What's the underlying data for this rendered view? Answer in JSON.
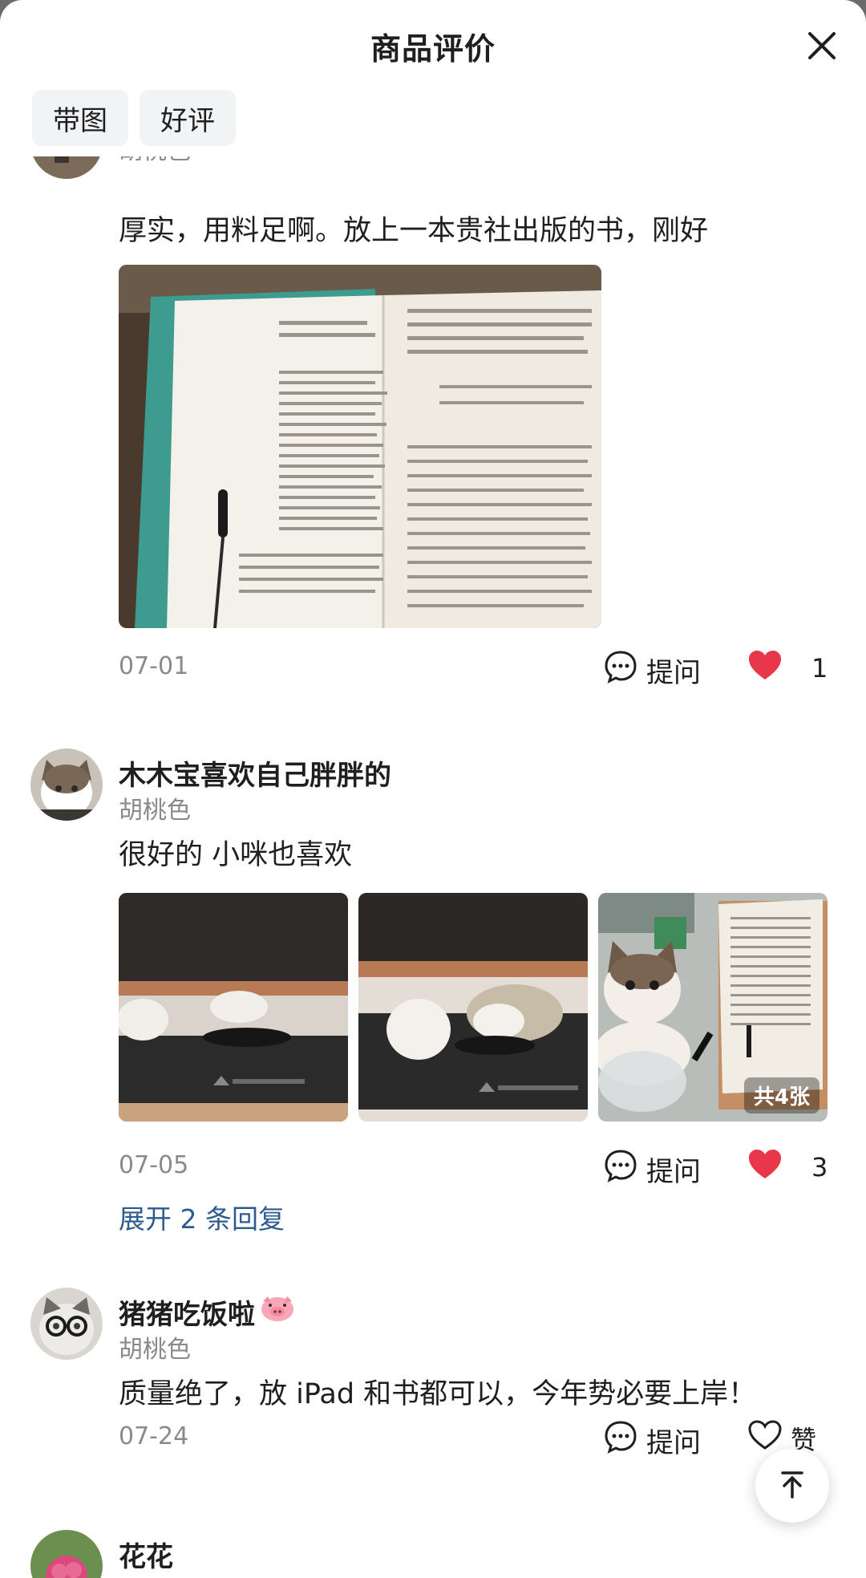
{
  "header": {
    "title": "商品评价"
  },
  "filters": [
    "带图",
    "好评"
  ],
  "reviews": [
    {
      "variant": "胡桃色",
      "text": "厚实，用料足啊。放上一本贵社出版的书，刚好",
      "date": "07-01",
      "ask_label": "提问",
      "like_count": "1",
      "liked": true
    },
    {
      "user": "木木宝喜欢自己胖胖的",
      "variant": "胡桃色",
      "text": "很好的 小咪也喜欢",
      "photo_count_badge": "共4张",
      "date": "07-05",
      "ask_label": "提问",
      "like_count": "3",
      "liked": true,
      "expand_replies": "展开 2 条回复"
    },
    {
      "user": "猪猪吃饭啦",
      "variant": "胡桃色",
      "text": "质量绝了，放 iPad 和书都可以，今年势必要上岸！",
      "date": "07-24",
      "ask_label": "提问",
      "like_label": "赞",
      "liked": false
    },
    {
      "user": "花花"
    }
  ],
  "colors": {
    "like_red": "#e8364a",
    "link_blue": "#2d5b8f",
    "chip_bg": "#f2f3f5"
  },
  "icons": [
    "close-icon",
    "comment-icon",
    "heart-icon",
    "heart-outline-icon",
    "arrow-up-icon",
    "pig-emoji-icon"
  ]
}
